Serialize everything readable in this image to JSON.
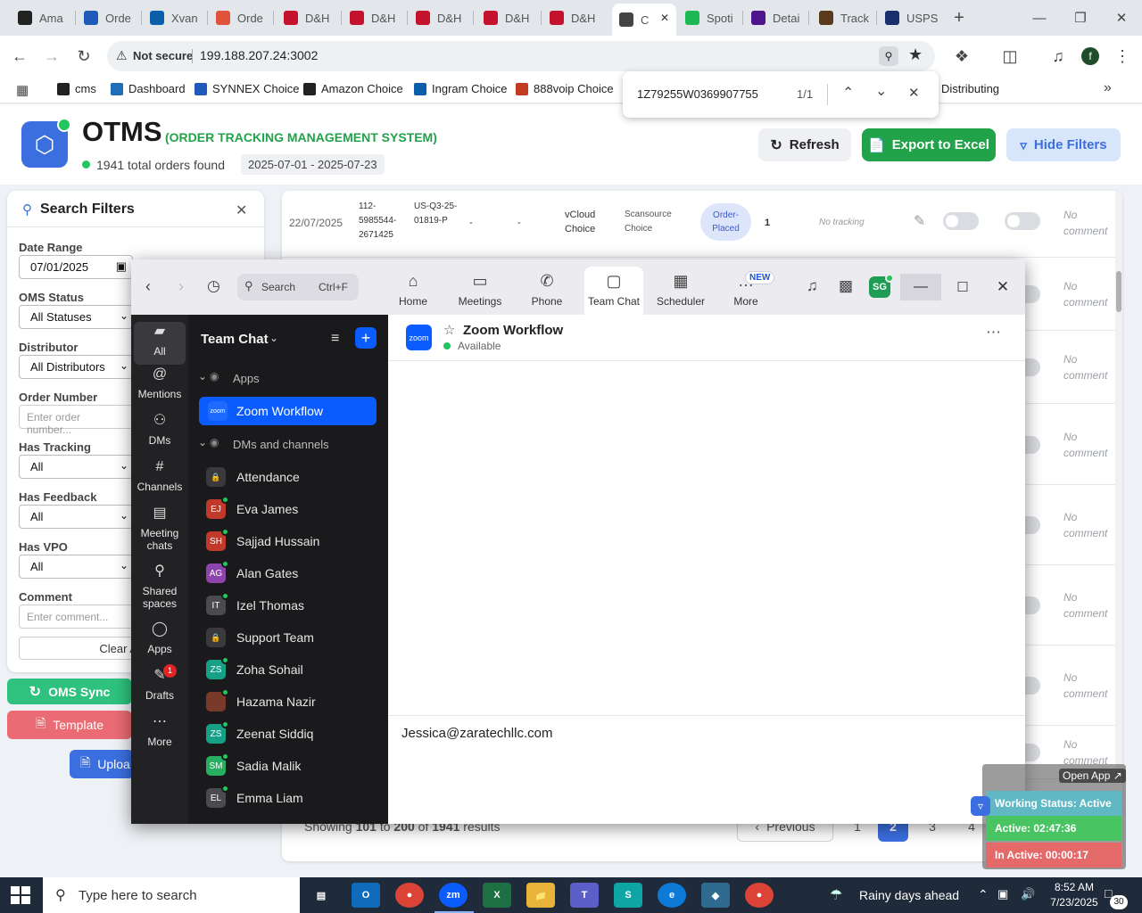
{
  "browser": {
    "tabs": [
      {
        "label": "Ama",
        "icon": "amazon-icon",
        "color": "#222222"
      },
      {
        "label": "Orde",
        "icon": "ec-icon",
        "color": "#1e5bb8"
      },
      {
        "label": "Xvan",
        "icon": "xvantage-icon",
        "color": "#0b5ea8"
      },
      {
        "label": "Orde",
        "icon": "orders-icon",
        "color": "#e0533a"
      },
      {
        "label": "D&H",
        "icon": "dh-icon",
        "color": "#c4122f"
      },
      {
        "label": "D&H",
        "icon": "dh-icon",
        "color": "#c4122f"
      },
      {
        "label": "D&H",
        "icon": "dh-icon",
        "color": "#c4122f"
      },
      {
        "label": "D&H",
        "icon": "dh-icon",
        "color": "#c4122f"
      },
      {
        "label": "D&H",
        "icon": "dh-icon",
        "color": "#c4122f"
      },
      {
        "label": "C",
        "icon": "otms-icon",
        "color": "#444444"
      },
      {
        "label": "Spoti",
        "icon": "spotify-icon",
        "color": "#1db954"
      },
      {
        "label": "Detai",
        "icon": "fedex-icon",
        "color": "#4d148c"
      },
      {
        "label": "Track",
        "icon": "ups-icon",
        "color": "#5a3a1a"
      },
      {
        "label": "USPS",
        "icon": "usps-icon",
        "color": "#1a2f6e"
      }
    ],
    "url_security": "Not secure",
    "url": "199.188.207.24:3002",
    "profile_initial": "f",
    "bookmarks": [
      {
        "label": "cms",
        "color": "#222222"
      },
      {
        "label": "Dashboard",
        "color": "#1e6fb8"
      },
      {
        "label": "SYNNEX Choice",
        "color": "#1e5bb8"
      },
      {
        "label": "Amazon Choice",
        "color": "#222222"
      },
      {
        "label": "Ingram Choice",
        "color": "#0b5ea8"
      },
      {
        "label": "888voip Choice",
        "color": "#c23b22"
      },
      {
        "label": "H Distributing",
        "color": "#c4122f"
      }
    ]
  },
  "findbar": {
    "query": "1Z79255W0369907755",
    "count": "1/1"
  },
  "app": {
    "title": "OTMS",
    "subtitle": "(ORDER TRACKING MANAGEMENT SYSTEM)",
    "orders_found": "1941 total orders found",
    "date_range": "2025-07-01 - 2025-07-23",
    "refresh_label": "Refresh",
    "export_label": "Export to Excel",
    "hide_filters_label": "Hide Filters",
    "accent": "#22b14c"
  },
  "filters": {
    "title": "Search Filters",
    "date_range_label": "Date Range",
    "date_from": "07/01/2025",
    "oms_status_label": "OMS Status",
    "oms_status_value": "All Statuses",
    "distributor_label": "Distributor",
    "distributor_value": "All Distributors",
    "order_number_label": "Order Number",
    "order_number_placeholder": "Enter order number...",
    "has_tracking_label": "Has Tracking",
    "has_tracking_value": "All",
    "has_feedback_label": "Has Feedback",
    "has_feedback_value": "All",
    "has_vpo_label": "Has VPO",
    "has_vpo_value": "All",
    "comment_label": "Comment",
    "comment_placeholder": "Enter comment...",
    "clear_label": "Clear A",
    "oms_sync_label": "OMS Sync",
    "template_label": "Template",
    "upload_label": "Uploa"
  },
  "table": {
    "first_row": {
      "date": "22/07/2025",
      "order_id": "112-5985544-2671425",
      "po": "US-Q3-25-01819-P",
      "col3": "-",
      "col4": "-",
      "distributor": "vCloud Choice",
      "source": "Scansource Choice",
      "status": "Order-Placed",
      "qty": "1",
      "tracking": "No tracking",
      "comment": "No comment"
    },
    "comment_text": "No comment",
    "pagination": {
      "showing_prefix": "Showing ",
      "from": "101",
      "to_word": " to ",
      "to": "200",
      "of_word": " of ",
      "total": "1941",
      "suffix": " results",
      "previous": "Previous",
      "pages": [
        "1",
        "2",
        "3",
        "4"
      ],
      "current": "2"
    }
  },
  "zoom": {
    "search_label": "Search",
    "search_shortcut": "Ctrl+F",
    "tabs": [
      {
        "label": "Home",
        "icon": "home-icon"
      },
      {
        "label": "Meetings",
        "icon": "video-icon"
      },
      {
        "label": "Phone",
        "icon": "phone-icon"
      },
      {
        "label": "Team Chat",
        "icon": "chat-icon"
      },
      {
        "label": "Scheduler",
        "icon": "calendar-icon"
      },
      {
        "label": "More",
        "icon": "more-icon"
      }
    ],
    "new_badge": "NEW",
    "avatar_initials": "SG",
    "rail": [
      {
        "label": "All",
        "icon": "chat-bubble-icon"
      },
      {
        "label": "Mentions",
        "icon": "at-icon"
      },
      {
        "label": "DMs",
        "icon": "people-icon"
      },
      {
        "label": "Channels",
        "icon": "hash-icon"
      },
      {
        "label": "Meeting chats",
        "icon": "meeting-chat-icon"
      },
      {
        "label": "Shared spaces",
        "icon": "shared-spaces-icon"
      },
      {
        "label": "Apps",
        "icon": "apps-icon"
      },
      {
        "label": "Drafts",
        "icon": "drafts-icon"
      },
      {
        "label": "More",
        "icon": "more-icon"
      }
    ],
    "drafts_badge": "1",
    "list_title": "Team Chat",
    "apps_section": "Apps",
    "selected_app": "Zoom Workflow",
    "dms_section": "DMs and channels",
    "channels": [
      {
        "name": "Attendance",
        "initials": "",
        "color": "#3a3a3d",
        "lock": true
      },
      {
        "name": "Eva James",
        "initials": "EJ",
        "color": "#c0392b"
      },
      {
        "name": "Sajjad Hussain",
        "initials": "SH",
        "color": "#c0392b"
      },
      {
        "name": "Alan Gates",
        "initials": "AG",
        "color": "#8e44ad"
      },
      {
        "name": "Izel Thomas",
        "initials": "IT",
        "color": "#4a4a4f"
      },
      {
        "name": "Support Team",
        "initials": "",
        "color": "#3a3a3d",
        "lock": true
      },
      {
        "name": "Zoha Sohail",
        "initials": "ZS",
        "color": "#16a085"
      },
      {
        "name": "Hazama Nazir",
        "initials": "",
        "color": "#7a3a2a"
      },
      {
        "name": "Zeenat Siddiq",
        "initials": "ZS",
        "color": "#16a085"
      },
      {
        "name": "Sadia Malik",
        "initials": "SM",
        "color": "#27ae60"
      },
      {
        "name": "Emma Liam",
        "initials": "EL",
        "color": "#4a4a4f"
      }
    ],
    "chat_title": "Zoom Workflow",
    "chat_status": "Available",
    "app_logo_text": "zoom",
    "composer_text": "Jessica@zaratechllc.com"
  },
  "work_status": {
    "open_app": "Open App ↗",
    "status": "Working Status: Active",
    "active": "Active: 02:47:36",
    "inactive": "In Active: 00:00:17"
  },
  "taskbar": {
    "search_placeholder": "Type here to search",
    "weather": "Rainy days ahead",
    "time": "8:52 AM",
    "date": "7/23/2025",
    "notifications": "30"
  }
}
